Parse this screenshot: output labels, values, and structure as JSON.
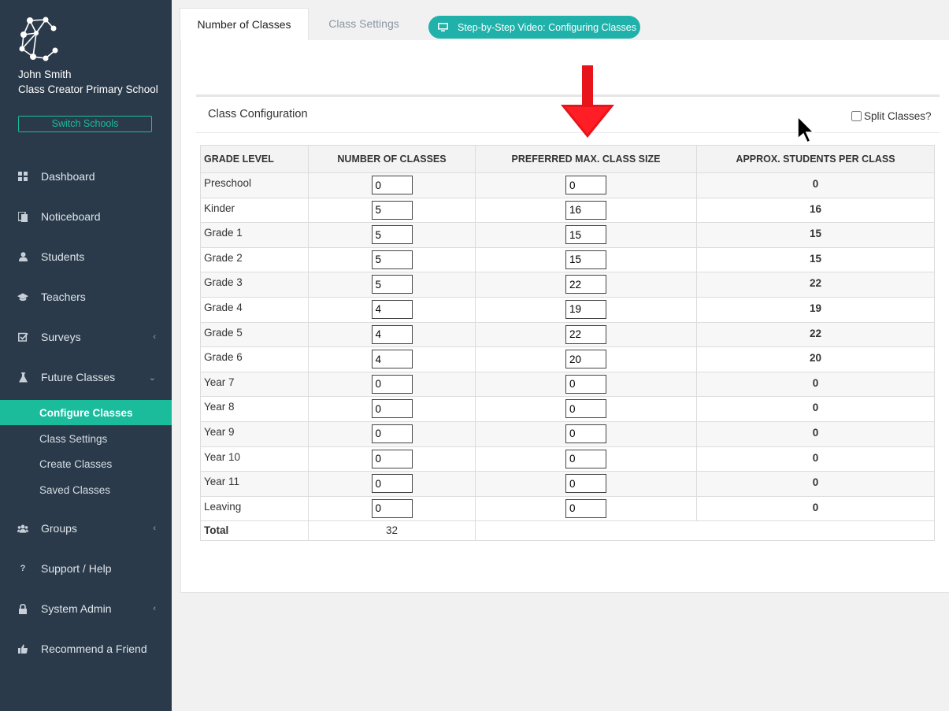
{
  "sidebar": {
    "user_name": "John Smith",
    "school_name": "Class Creator Primary School",
    "switch_label": "Switch Schools",
    "nav": [
      {
        "label": "Dashboard",
        "icon": "dashboard-icon"
      },
      {
        "label": "Noticeboard",
        "icon": "noticeboard-icon"
      },
      {
        "label": "Students",
        "icon": "user-icon"
      },
      {
        "label": "Teachers",
        "icon": "graduation-cap-icon"
      },
      {
        "label": "Surveys",
        "icon": "check-square-icon"
      },
      {
        "label": "Future Classes",
        "icon": "flask-icon"
      }
    ],
    "future_sub": [
      {
        "label": "Configure Classes"
      },
      {
        "label": "Class Settings"
      },
      {
        "label": "Create Classes"
      },
      {
        "label": "Saved Classes"
      }
    ],
    "nav2": [
      {
        "label": "Groups",
        "icon": "users-icon"
      },
      {
        "label": "Support / Help",
        "icon": "question-icon"
      },
      {
        "label": "System Admin",
        "icon": "lock-icon"
      },
      {
        "label": "Recommend a Friend",
        "icon": "thumbs-up-icon"
      }
    ]
  },
  "tabs": [
    {
      "label": "Number of Classes"
    },
    {
      "label": "Class Settings"
    }
  ],
  "video_button": "Step-by-Step Video: Configuring Classes",
  "config": {
    "title": "Class Configuration",
    "split_label": "Split Classes?",
    "headers": [
      "GRADE LEVEL",
      "NUMBER OF CLASSES",
      "PREFERRED MAX. CLASS SIZE",
      "APPROX. STUDENTS PER CLASS"
    ],
    "rows": [
      {
        "grade": "Preschool",
        "num": "0",
        "size": "0",
        "approx": "0"
      },
      {
        "grade": "Kinder",
        "num": "5",
        "size": "16",
        "approx": "16"
      },
      {
        "grade": "Grade 1",
        "num": "5",
        "size": "15",
        "approx": "15"
      },
      {
        "grade": "Grade 2",
        "num": "5",
        "size": "15",
        "approx": "15"
      },
      {
        "grade": "Grade 3",
        "num": "5",
        "size": "22",
        "approx": "22"
      },
      {
        "grade": "Grade 4",
        "num": "4",
        "size": "19",
        "approx": "19"
      },
      {
        "grade": "Grade 5",
        "num": "4",
        "size": "22",
        "approx": "22"
      },
      {
        "grade": "Grade 6",
        "num": "4",
        "size": "20",
        "approx": "20"
      },
      {
        "grade": "Year 7",
        "num": "0",
        "size": "0",
        "approx": "0"
      },
      {
        "grade": "Year 8",
        "num": "0",
        "size": "0",
        "approx": "0"
      },
      {
        "grade": "Year 9",
        "num": "0",
        "size": "0",
        "approx": "0"
      },
      {
        "grade": "Year 10",
        "num": "0",
        "size": "0",
        "approx": "0"
      },
      {
        "grade": "Year 11",
        "num": "0",
        "size": "0",
        "approx": "0"
      },
      {
        "grade": "Leaving",
        "num": "0",
        "size": "0",
        "approx": "0"
      }
    ],
    "total_label": "Total",
    "total_value": "32"
  },
  "colors": {
    "sidebar_bg": "#2b3a4a",
    "accent": "#1abc9c",
    "video_btn": "#20b2aa",
    "arrow": "#e8141b"
  }
}
